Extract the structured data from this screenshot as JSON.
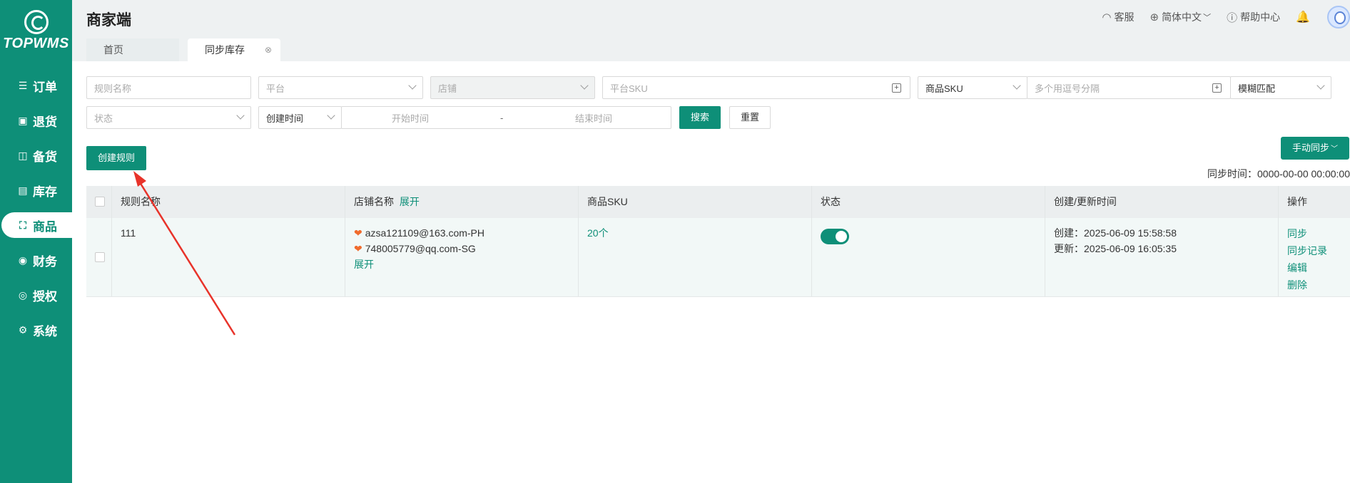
{
  "app": {
    "logo_text": "TOPWMS",
    "title": "商家端"
  },
  "sidebar": {
    "items": [
      {
        "label": "订单",
        "icon": "list-icon"
      },
      {
        "label": "退货",
        "icon": "return-box-icon"
      },
      {
        "label": "备货",
        "icon": "bag-icon"
      },
      {
        "label": "库存",
        "icon": "inventory-icon"
      },
      {
        "label": "商品",
        "icon": "shopping-bag-icon"
      },
      {
        "label": "财务",
        "icon": "finance-icon"
      },
      {
        "label": "授权",
        "icon": "authorize-icon"
      },
      {
        "label": "系统",
        "icon": "gear-icon"
      }
    ],
    "active_index": 4
  },
  "header": {
    "customer_service": "客服",
    "language": "简体中文",
    "help_center": "帮助中心"
  },
  "tabs": [
    {
      "label": "首页"
    },
    {
      "label": "同步库存"
    }
  ],
  "filters": {
    "rule_name_placeholder": "规则名称",
    "platform_placeholder": "平台",
    "store_placeholder": "店铺",
    "platform_sku_placeholder": "平台SKU",
    "sku_type_value": "商品SKU",
    "multi_placeholder": "多个用逗号分隔",
    "match_mode_value": "模糊匹配",
    "status_placeholder": "状态",
    "time_type_value": "创建时间",
    "start_time_placeholder": "开始时间",
    "range_separator": "-",
    "end_time_placeholder": "结束时间",
    "search_label": "搜索",
    "reset_label": "重置"
  },
  "actions": {
    "create_rule_label": "创建规则",
    "manual_sync_label": "手动同步",
    "sync_time_label": "同步时间：",
    "sync_time_value": "0000-00-00 00:00:00"
  },
  "table": {
    "headers": {
      "rule_name": "规则名称",
      "store_name": "店铺名称",
      "store_expand": "展开",
      "sku": "商品SKU",
      "status": "状态",
      "time": "创建/更新时间",
      "ops": "操作"
    },
    "rows": [
      {
        "rule_name": "111",
        "stores": [
          "azsa121109@163.com-PH",
          "748005779@qq.com-SG"
        ],
        "expand": "展开",
        "sku": "20个",
        "status_on": true,
        "created_label": "创建：",
        "created": "2025-06-09 15:58:58",
        "updated_label": "更新：",
        "updated": "2025-06-09 16:05:35",
        "ops": [
          "同步",
          "同步记录",
          "编辑",
          "删除"
        ]
      }
    ]
  },
  "colors": {
    "brand": "#0e8f78",
    "annotation_arrow": "#e8332a"
  }
}
